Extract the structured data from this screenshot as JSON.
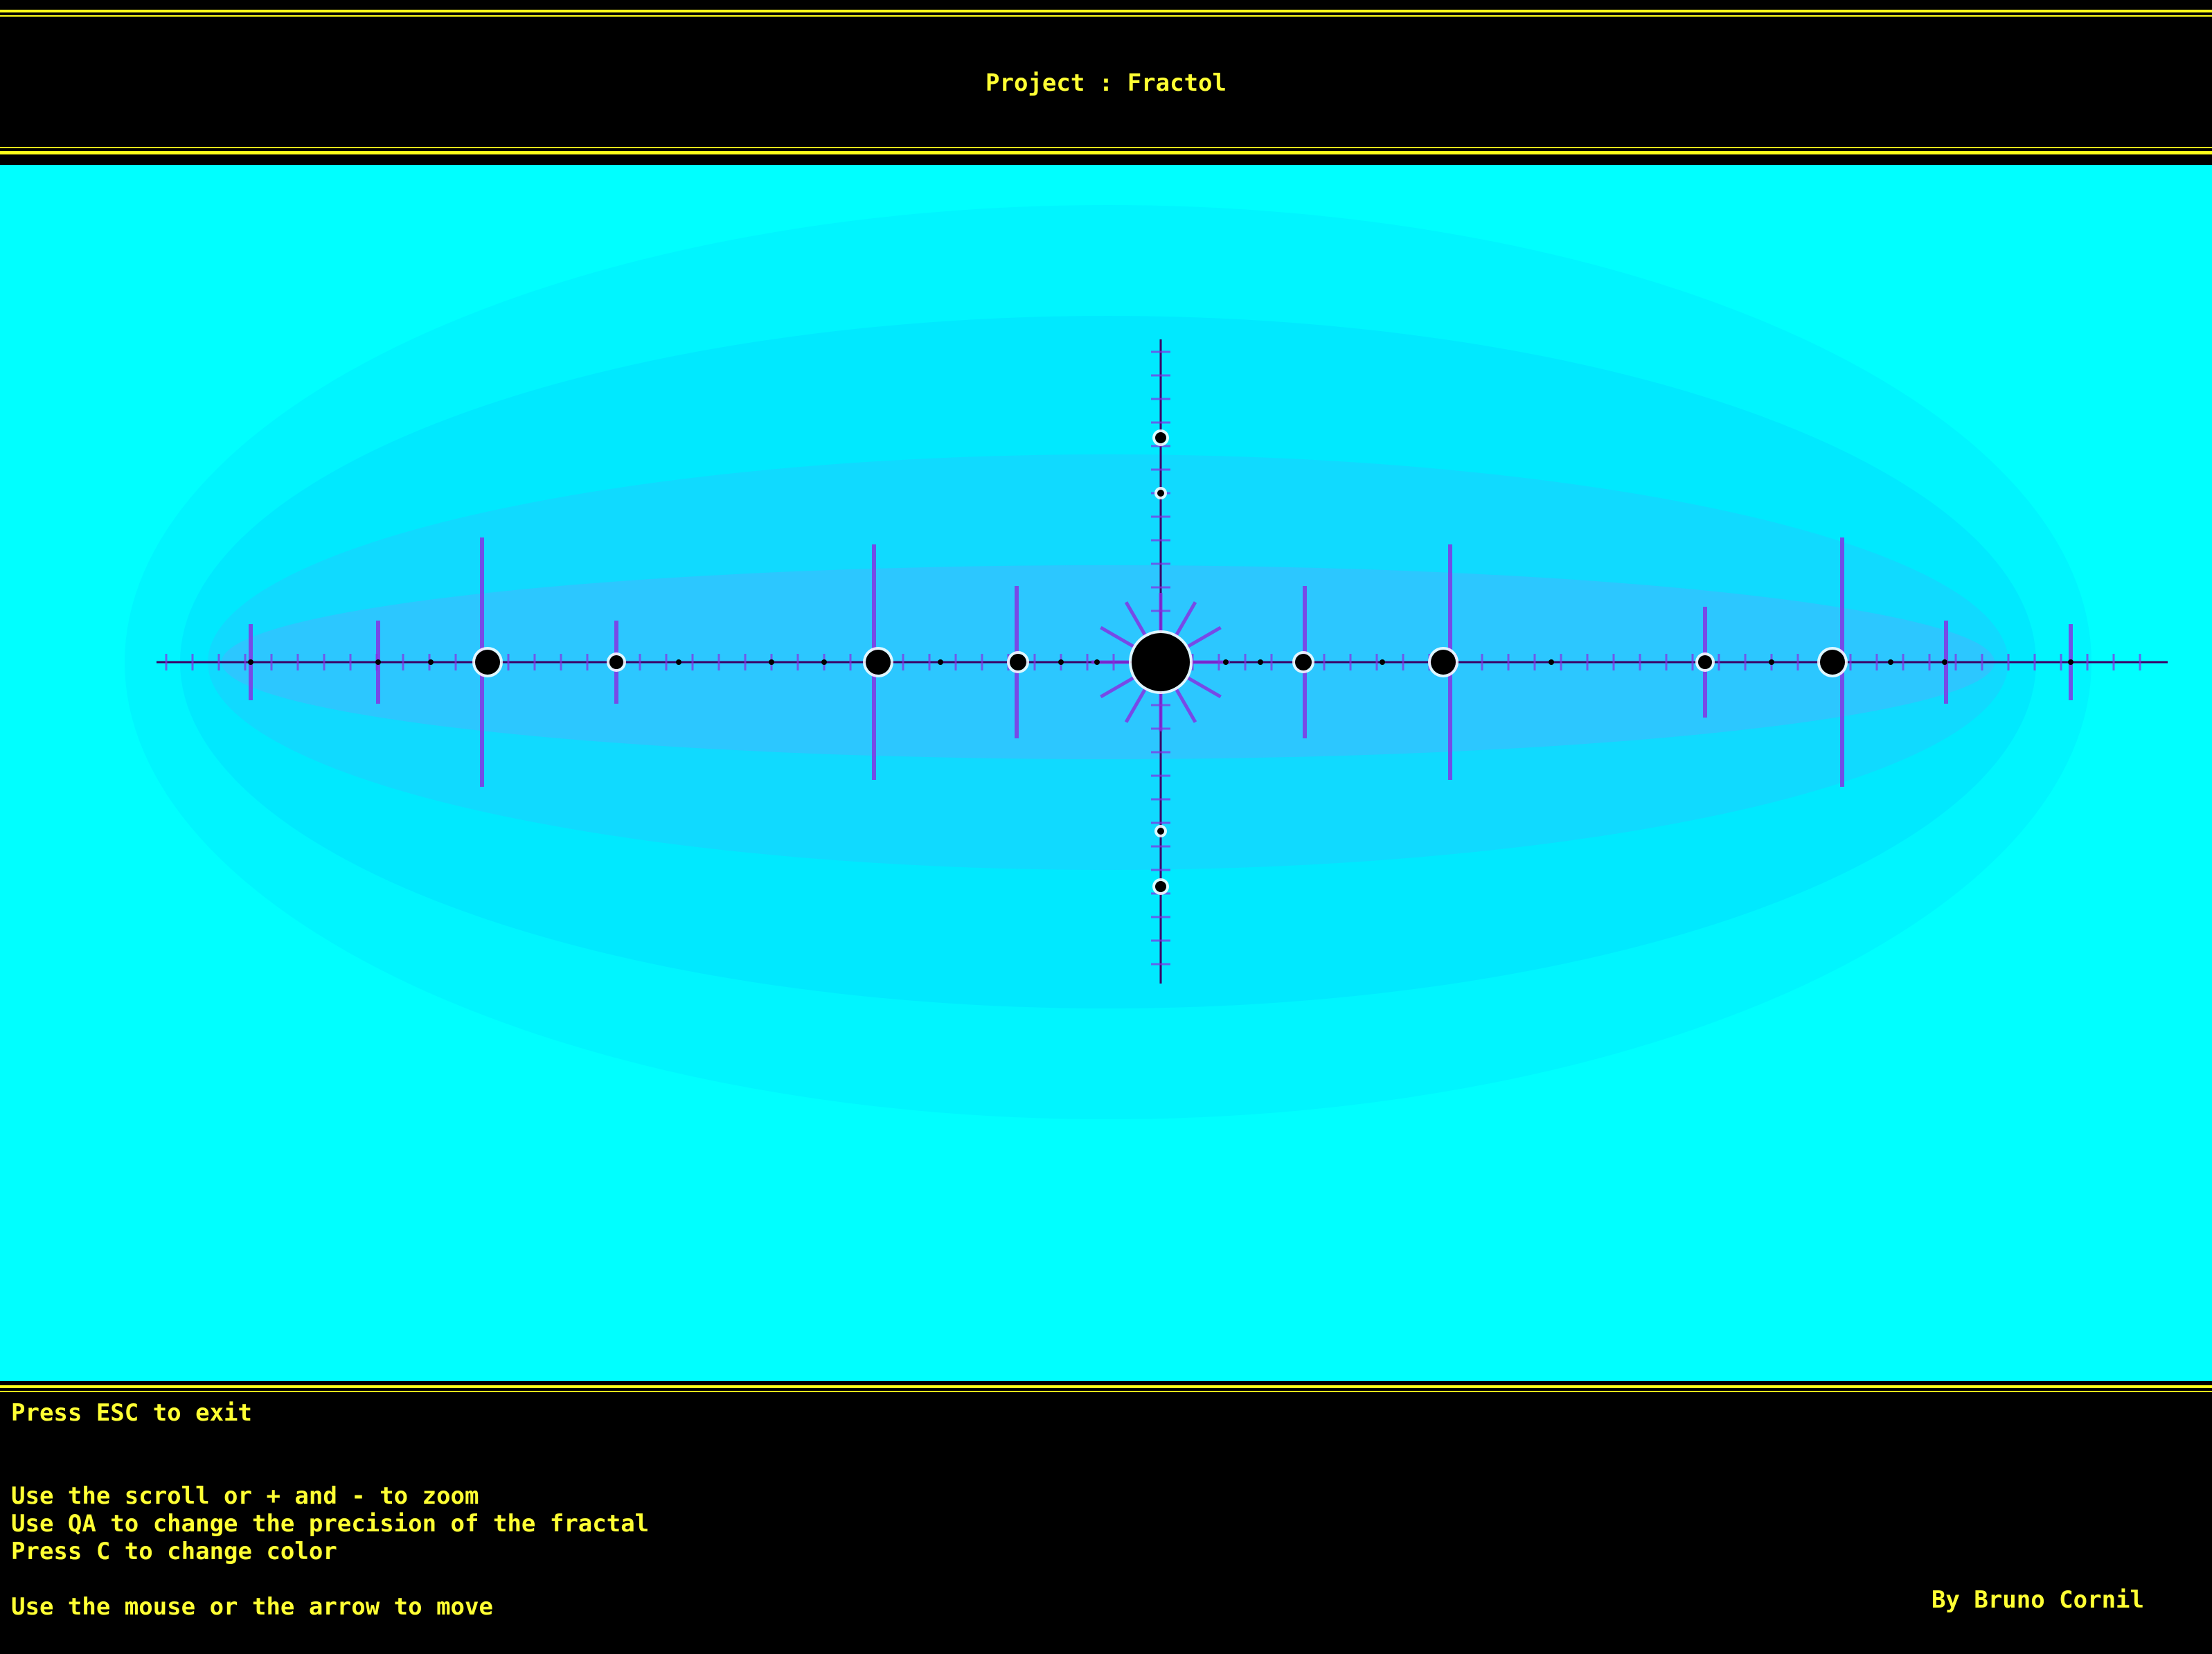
{
  "header": {
    "title": "Project : Fractol"
  },
  "fractal": {
    "background_color": "#00ffff",
    "set_color": "#000000",
    "filament_color": "#8a2be2",
    "halo_colors": [
      "#00f4ff",
      "#00e8ff",
      "#12d8ff",
      "#30c4ff"
    ]
  },
  "footer": {
    "instructions": [
      "Press ESC to exit",
      "Use the scroll or + and - to zoom",
      "Use QA to change the precision of the fractal",
      "Press C to change color",
      "Use the mouse or the arrow to move"
    ],
    "author": "By Bruno Cornil"
  },
  "colors": {
    "accent": "#ffff33",
    "frame": "#000000"
  }
}
